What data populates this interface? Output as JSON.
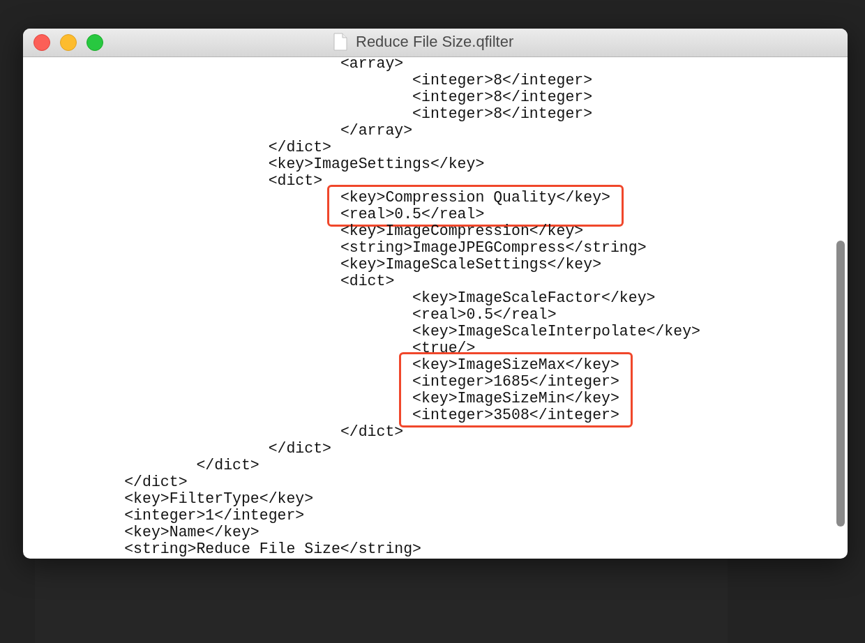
{
  "window": {
    "title": "Reduce File Size.qfilter"
  },
  "blocks": [
    {
      "kind": "plain",
      "lines": [
        "\t\t\t\t<array>",
        "\t\t\t\t\t<integer>8</integer>",
        "\t\t\t\t\t<integer>8</integer>",
        "\t\t\t\t\t<integer>8</integer>",
        "\t\t\t\t</array>",
        "\t\t\t</dict>",
        "\t\t\t<key>ImageSettings</key>",
        "\t\t\t<dict>"
      ]
    },
    {
      "kind": "highlight",
      "lines": [
        "\t\t\t\t<key>Compression Quality</key>",
        "\t\t\t\t<real>0.5</real>"
      ]
    },
    {
      "kind": "plain",
      "lines": [
        "\t\t\t\t<key>ImageCompression</key>",
        "\t\t\t\t<string>ImageJPEGCompress</string>",
        "\t\t\t\t<key>ImageScaleSettings</key>",
        "\t\t\t\t<dict>",
        "\t\t\t\t\t<key>ImageScaleFactor</key>",
        "\t\t\t\t\t<real>0.5</real>",
        "\t\t\t\t\t<key>ImageScaleInterpolate</key>",
        "\t\t\t\t\t<true/>"
      ]
    },
    {
      "kind": "highlight",
      "lines": [
        "\t\t\t\t\t<key>ImageSizeMax</key>",
        "\t\t\t\t\t<integer>1685</integer>",
        "\t\t\t\t\t<key>ImageSizeMin</key>",
        "\t\t\t\t\t<integer>3508</integer>"
      ]
    },
    {
      "kind": "plain",
      "lines": [
        "\t\t\t\t</dict>",
        "\t\t\t</dict>",
        "\t\t</dict>",
        "\t</dict>",
        "\t<key>FilterType</key>",
        "\t<integer>1</integer>",
        "\t<key>Name</key>",
        "\t<string>Reduce File Size</string>"
      ]
    }
  ]
}
